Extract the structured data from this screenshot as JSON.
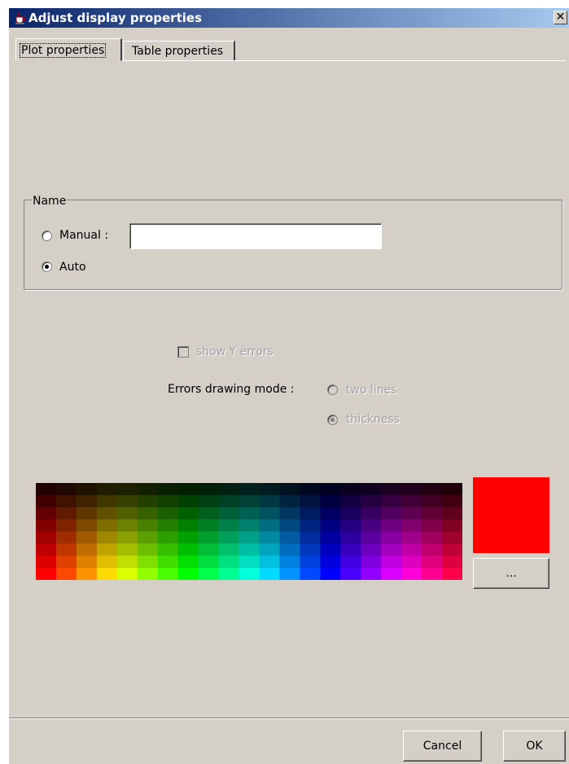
{
  "window": {
    "title": "Adjust display properties",
    "close_symbol": "✕"
  },
  "tabs": [
    {
      "label": "Plot properties",
      "active": true
    },
    {
      "label": "Table properties",
      "active": false
    }
  ],
  "name_group": {
    "title": "Name",
    "manual_label": "Manual :",
    "manual_value": "",
    "auto_label": "Auto",
    "selected": "Auto"
  },
  "errors": {
    "show_y_errors_label": "show Y errors",
    "show_y_errors_checked": false,
    "mode_label": "Errors drawing mode :",
    "option_two_lines": "two lines",
    "option_thickness": "thickness",
    "selected_mode": "thickness",
    "enabled": false
  },
  "color": {
    "selected": "#ff0000",
    "more_button_label": "..."
  },
  "footer": {
    "cancel_label": "Cancel",
    "ok_label": "OK"
  },
  "icons": {
    "app": "java-cup-icon",
    "close": "close-icon"
  }
}
